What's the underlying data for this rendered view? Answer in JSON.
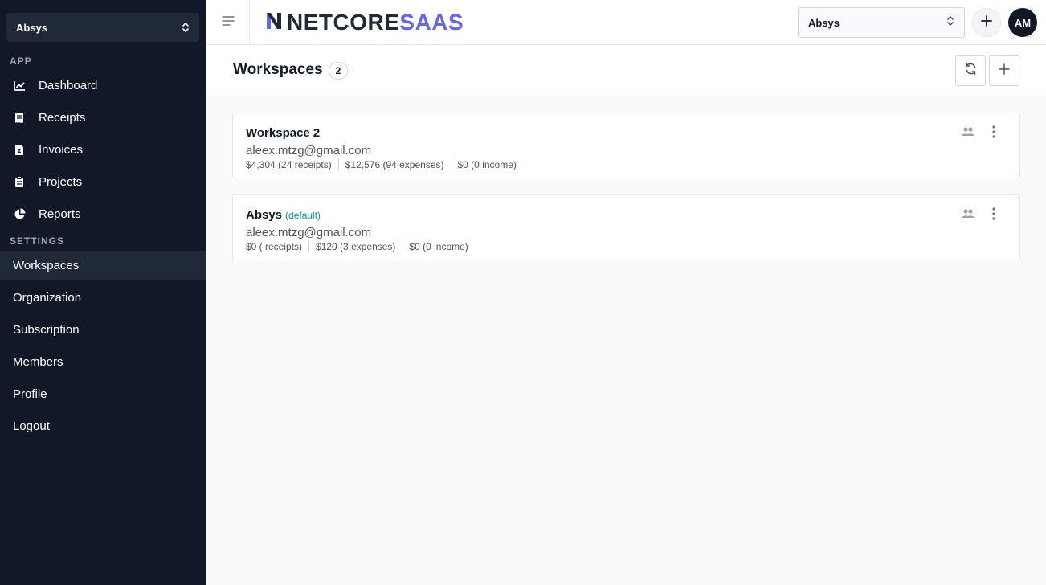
{
  "sidebar": {
    "workspace_selector": "Absys",
    "app_section": "APP",
    "app_items": [
      {
        "label": "Dashboard",
        "icon": "chart-line-icon"
      },
      {
        "label": "Receipts",
        "icon": "receipt-icon"
      },
      {
        "label": "Invoices",
        "icon": "invoice-icon"
      },
      {
        "label": "Projects",
        "icon": "clipboard-icon"
      },
      {
        "label": "Reports",
        "icon": "pie-chart-icon"
      }
    ],
    "settings_section": "SETTINGS",
    "settings_items": [
      {
        "label": "Workspaces",
        "active": true
      },
      {
        "label": "Organization"
      },
      {
        "label": "Subscription"
      },
      {
        "label": "Members"
      },
      {
        "label": "Profile"
      },
      {
        "label": "Logout"
      }
    ]
  },
  "topbar": {
    "logo_part1": "NETCORE",
    "logo_part2": "SAAS",
    "workspace_select": "Absys",
    "avatar_initials": "AM"
  },
  "page": {
    "title": "Workspaces",
    "count": "2"
  },
  "workspaces": [
    {
      "name": "Workspace 2",
      "default_tag": "",
      "email": "aleex.mtzg@gmail.com",
      "receipts": "$4,304 (24 receipts)",
      "expenses": "$12,576 (94 expenses)",
      "income": "$0 (0 income)"
    },
    {
      "name": "Absys",
      "default_tag": "(default)",
      "email": "aleex.mtzg@gmail.com",
      "receipts": "$0 ( receipts)",
      "expenses": "$120 (3 expenses)",
      "income": "$0 (0 income)"
    }
  ],
  "colors": {
    "sidebar_bg": "#111827",
    "sidebar_active": "#1f2937",
    "brand_accent": "#6366f1",
    "default_tag": "#0d9488"
  }
}
